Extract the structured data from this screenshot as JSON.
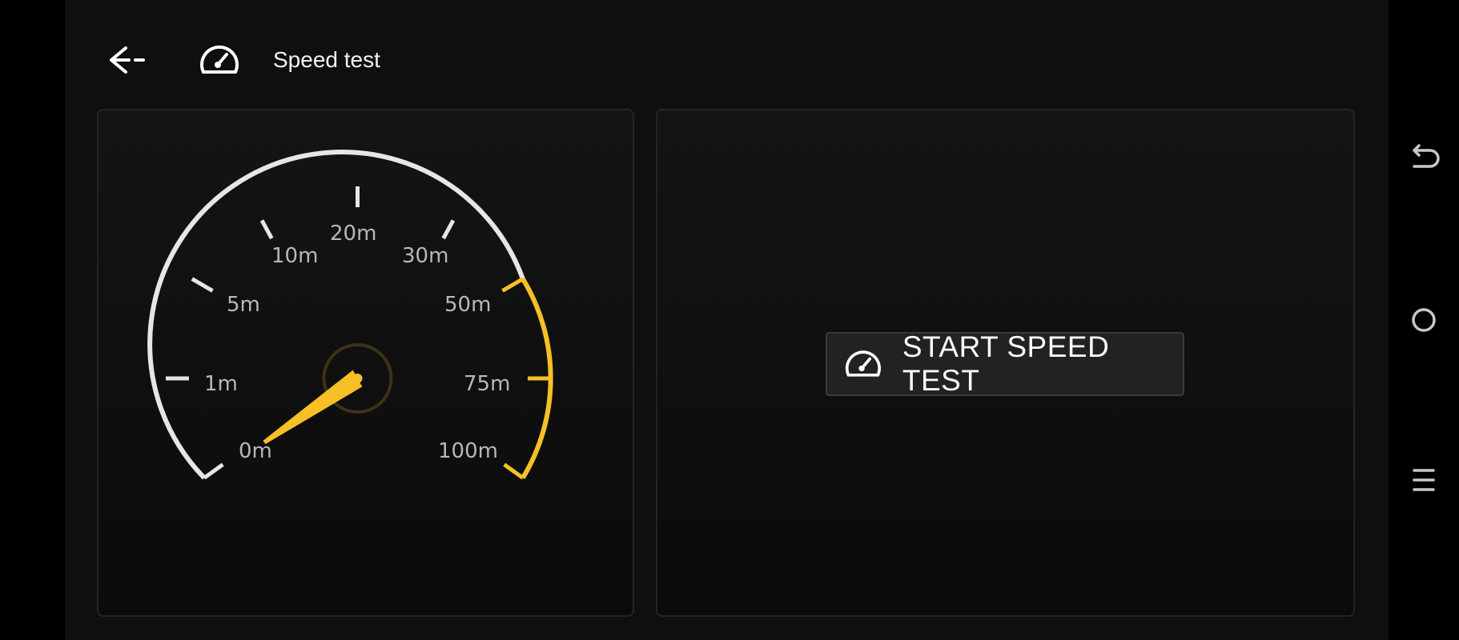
{
  "header": {
    "title": "Speed test",
    "back_icon": "arrow-left-icon",
    "title_icon": "speedometer-icon"
  },
  "gauge": {
    "labels": [
      "0m",
      "1m",
      "5m",
      "10m",
      "20m",
      "30m",
      "50m",
      "75m",
      "100m"
    ],
    "current_value": "0m",
    "colors": {
      "scale": "#e6e6e6",
      "high_range": "#f6c026",
      "needle": "#f6c026",
      "label": "#b8b8b8"
    }
  },
  "action": {
    "start_label": "START SPEED TEST",
    "icon": "speedometer-icon"
  },
  "system_nav": {
    "back_icon": "undo-arrow-icon",
    "home_icon": "circle-home-icon",
    "menu_icon": "hamburger-menu-icon"
  },
  "colors": {
    "background": "#0f0f0f",
    "panel_border": "#242424",
    "accent": "#f6c026"
  }
}
